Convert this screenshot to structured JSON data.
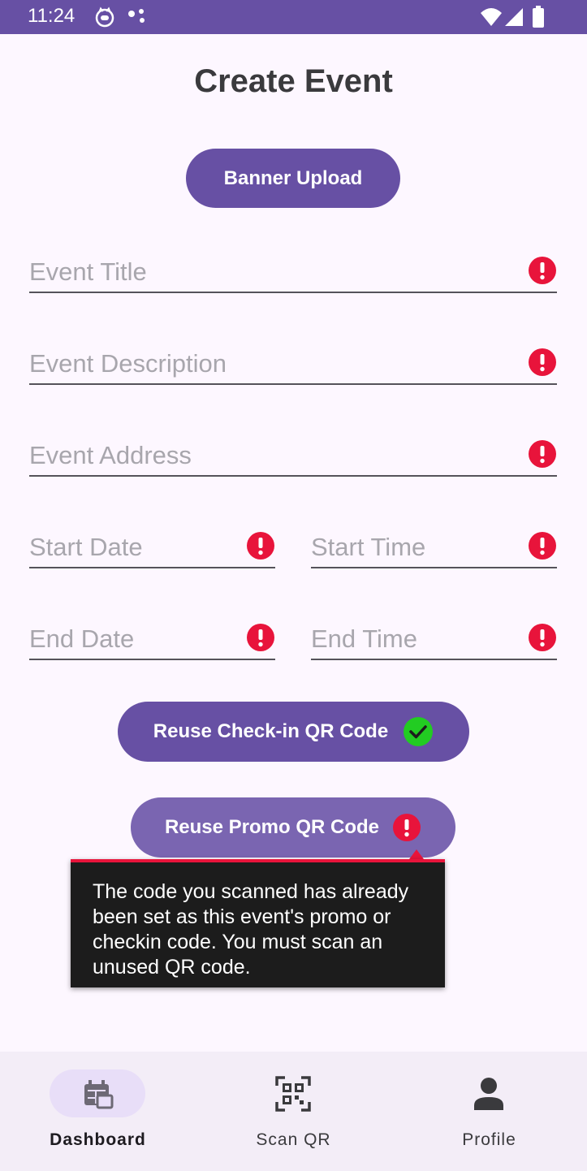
{
  "status_bar": {
    "time": "11:24",
    "icons": [
      "cat-face-icon",
      "dots-icon",
      "wifi-icon",
      "signal-icon",
      "battery-icon"
    ]
  },
  "page": {
    "title": "Create Event"
  },
  "banner_upload": {
    "label": "Banner Upload"
  },
  "fields": {
    "event_title": {
      "placeholder": "Event Title"
    },
    "event_description": {
      "placeholder": "Event Description"
    },
    "event_address": {
      "placeholder": "Event Address"
    },
    "start_date": {
      "placeholder": "Start Date"
    },
    "start_time": {
      "placeholder": "Start Time"
    },
    "end_date": {
      "placeholder": "End Date"
    },
    "end_time": {
      "placeholder": "End Time"
    }
  },
  "reuse_checkin": {
    "label": "Reuse Check-in QR Code",
    "status_icon": "check-circle-icon"
  },
  "reuse_promo": {
    "label": "Reuse Promo QR Code",
    "status_icon": "error-icon"
  },
  "tooltip": {
    "text": "The code you scanned has already been set as this event's promo or checkin code. You must scan an unused QR code."
  },
  "nav": {
    "items": [
      {
        "label": "Dashboard",
        "icon": "dashboard-icon",
        "active": true
      },
      {
        "label": "Scan QR",
        "icon": "qr-scan-icon",
        "active": false
      },
      {
        "label": "Profile",
        "icon": "person-icon",
        "active": false
      }
    ]
  },
  "colors": {
    "primary": "#6750a4",
    "error": "#e8143b",
    "success": "#22cc22",
    "background": "#fdf7ff",
    "nav_background": "#f3edf7",
    "nav_active_pill": "#e8def8"
  }
}
